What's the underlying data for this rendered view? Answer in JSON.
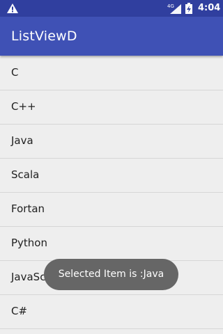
{
  "status_bar": {
    "time": "4:04",
    "network_label": "4G",
    "icons": [
      "warning-icon",
      "signal-icon",
      "battery-charging-icon"
    ]
  },
  "app_bar": {
    "title": "ListViewD"
  },
  "list": {
    "items": [
      {
        "label": "C"
      },
      {
        "label": "C++"
      },
      {
        "label": "Java"
      },
      {
        "label": "Scala"
      },
      {
        "label": "Fortan"
      },
      {
        "label": "Python"
      },
      {
        "label": "JavaScript"
      },
      {
        "label": "C#"
      }
    ]
  },
  "toast": {
    "message": "Selected Item is :Java"
  },
  "colors": {
    "status_bar": "#303f9f",
    "app_bar": "#3f51b5",
    "background": "#eeeeee",
    "divider": "#d6d6d6",
    "toast": "#666666"
  }
}
